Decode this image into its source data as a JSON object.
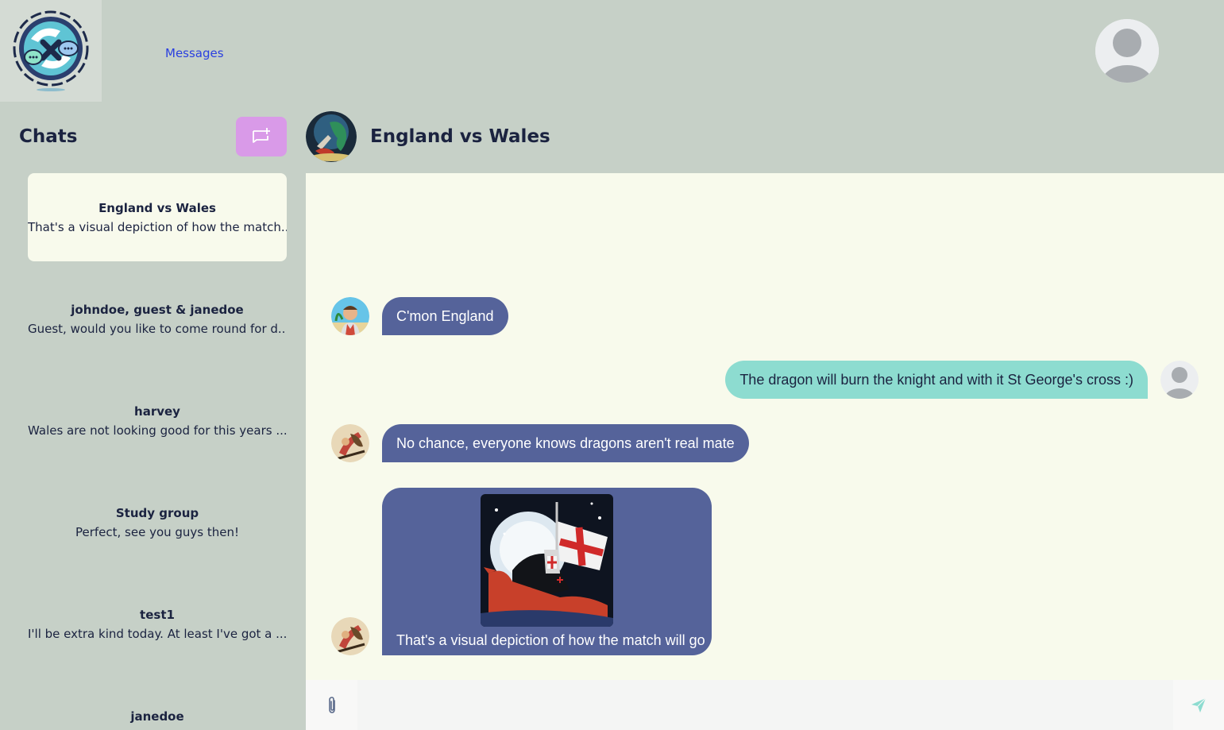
{
  "header": {
    "nav_messages": "Messages"
  },
  "sidebar": {
    "title": "Chats",
    "chats": [
      {
        "name": "England vs Wales",
        "preview": "That's a visual depiction of how the match..."
      },
      {
        "name": "johndoe, guest & janedoe",
        "preview": "Guest, would you like to come round for d..."
      },
      {
        "name": "harvey",
        "preview": "Wales are not looking good for this years ..."
      },
      {
        "name": "Study group",
        "preview": "Perfect, see you guys then!"
      },
      {
        "name": "test1",
        "preview": "I'll be extra kind today. At least I've got a ..."
      },
      {
        "name": "janedoe",
        "preview": ""
      }
    ]
  },
  "chat": {
    "title": "England vs Wales",
    "messages": [
      {
        "direction": "incoming",
        "text": "C'mon England"
      },
      {
        "direction": "outgoing",
        "text": "The dragon will burn the knight and with it St George's cross :)"
      },
      {
        "direction": "incoming",
        "text": "No chance, everyone knows dragons aren't real mate"
      },
      {
        "direction": "incoming",
        "text": "That's a visual depiction of how the match will go",
        "has_image": true
      }
    ]
  },
  "composer": {
    "placeholder": ""
  },
  "colors": {
    "background": "#c6d0c7",
    "active_chat": "#f8faec",
    "new_chat_button": "#d99ae8",
    "incoming_bubble": "#55639a",
    "outgoing_bubble": "#8ddcd0",
    "nav_link": "#2a3fe0"
  },
  "icons": {
    "logo": "chat-exchange-logo",
    "new_chat": "message-plus-icon",
    "attach": "paperclip-icon",
    "send": "send-icon",
    "user": "user-avatar-icon"
  }
}
